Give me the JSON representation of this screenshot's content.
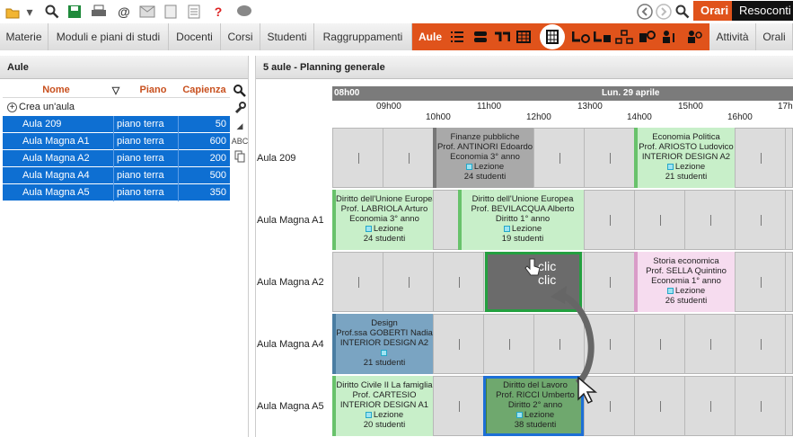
{
  "toolbar": {
    "icons": [
      "folder-open-icon",
      "menu-arrow-icon",
      "search-icon",
      "save-icon",
      "print-icon",
      "at-icon",
      "mail-icon",
      "document-icon",
      "list-icon",
      "help-icon",
      "chat-icon"
    ],
    "tabs": [
      {
        "label": "Orari",
        "active": true
      },
      {
        "label": "Resoconti",
        "active": false
      }
    ]
  },
  "menu": {
    "items": [
      "Materie",
      "Moduli e piani di studi",
      "Docenti",
      "Corsi",
      "Studenti",
      "Raggruppamenti",
      "Aule",
      "Attività",
      "Orali"
    ],
    "active": "Aule"
  },
  "left_panel": {
    "title": "Aule",
    "columns": [
      "Nome",
      "Piano",
      "Capienza"
    ],
    "create_label": "Crea un'aula",
    "rooms": [
      {
        "name": "Aula 209",
        "floor": "piano terra",
        "capacity": "50"
      },
      {
        "name": "Aula Magna  A1",
        "floor": "piano terra",
        "capacity": "600"
      },
      {
        "name": "Aula Magna  A2",
        "floor": "piano terra",
        "capacity": "200"
      },
      {
        "name": "Aula Magna  A4",
        "floor": "piano terra",
        "capacity": "500"
      },
      {
        "name": "Aula Magna  A5",
        "floor": "piano terra",
        "capacity": "350"
      }
    ],
    "side_tools": [
      "ABC"
    ]
  },
  "right_panel": {
    "title": "5 aule - Planning generale",
    "start_label": "08h00",
    "day_label": "Lun. 29 aprile",
    "hours_top": [
      "09h00",
      "11h00",
      "13h00",
      "15h00",
      "17h"
    ],
    "hours_bottom": [
      "10h00",
      "12h00",
      "14h00",
      "16h00"
    ],
    "room_labels": [
      "Aula 209",
      "Aula Magna  A1",
      "Aula Magna  A2",
      "Aula Magna  A4",
      "Aula Magna  A5"
    ],
    "clic_text": [
      "clic",
      "clic"
    ],
    "lessons": [
      {
        "subject": "Finanze pubbliche",
        "teacher": "Prof. ANTINORI Edoardo",
        "course": "Economia 3° anno",
        "type": "Lezione",
        "students": "24 studenti"
      },
      {
        "subject": "Economia Politica",
        "teacher": "Prof. ARIOSTO Ludovico",
        "course": "INTERIOR DESIGN A2",
        "type": "Lezione",
        "students": "21 studenti"
      },
      {
        "subject": "Diritto dell'Unione Europea",
        "teacher": "Prof. LABRIOLA Arturo",
        "course": "Economia 3° anno",
        "type": "Lezione",
        "students": "24 studenti"
      },
      {
        "subject": "Diritto dell'Unione Europea",
        "teacher": "Prof. BEVILACQUA Alberto",
        "course": "Diritto 1° anno",
        "type": "Lezione",
        "students": "19 studenti"
      },
      {
        "subject": "Storia economica",
        "teacher": "Prof. SELLA Quintino",
        "course": "Economia 1° anno",
        "type": "Lezione",
        "students": "26 studenti"
      },
      {
        "subject": "Design",
        "teacher": "Prof.ssa GOBERTI Nadia",
        "course": "INTERIOR DESIGN A2",
        "type": "",
        "students": "21 studenti"
      },
      {
        "subject": "Diritto Civile II La famiglia",
        "teacher": "Prof. CARTESIO",
        "course": "INTERIOR DESIGN A1",
        "type": "Lezione",
        "students": "20 studenti"
      },
      {
        "subject": "Diritto del Lavoro",
        "teacher": "Prof. RICCI Umberto",
        "course": "Diritto 2° anno",
        "type": "Lezione",
        "students": "38 studenti"
      }
    ]
  },
  "colors": {
    "accent": "#e0531b",
    "selection": "#0e6fd2",
    "lesson_green": "#c8efc9",
    "lesson_pink": "#f6dcef",
    "lesson_blue": "#7aa4c2"
  }
}
